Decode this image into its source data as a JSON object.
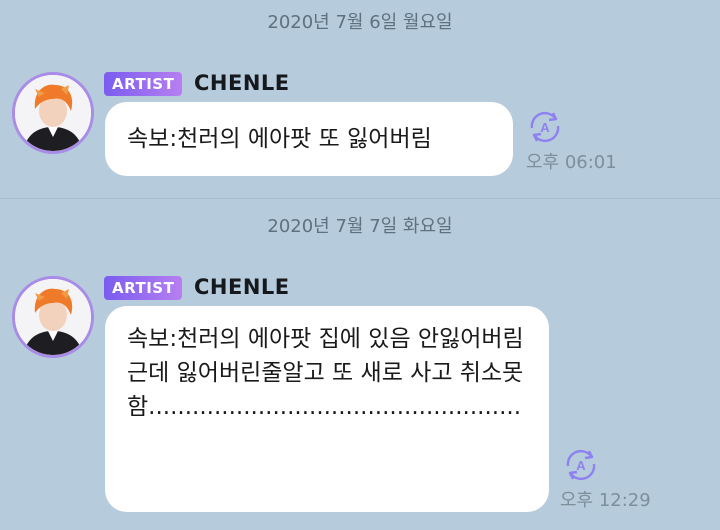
{
  "messages": [
    {
      "date": "2020년 7월 6일 월요일",
      "badge": "ARTIST",
      "sender": "CHENLE",
      "text": "속보:천러의 에아팟 또 잃어버림",
      "time": "오후 06:01"
    },
    {
      "date": "2020년 7월 7일 화요일",
      "badge": "ARTIST",
      "sender": "CHENLE",
      "text": "속보:천러의 에아팟 집에 있음 안잃어버림 근데 잃어버린줄알고 또 새로 사고 취소못함...................................................",
      "time": "오후 12:29"
    }
  ],
  "colors": {
    "background": "#b6cbdb",
    "badge_start": "#7a5cf0",
    "badge_end": "#b77ff0",
    "avatar_ring": "#a98be8",
    "translate_icon": "#8e82f0"
  },
  "icons": {
    "translate": "translate-icon",
    "avatar": "avatar"
  }
}
